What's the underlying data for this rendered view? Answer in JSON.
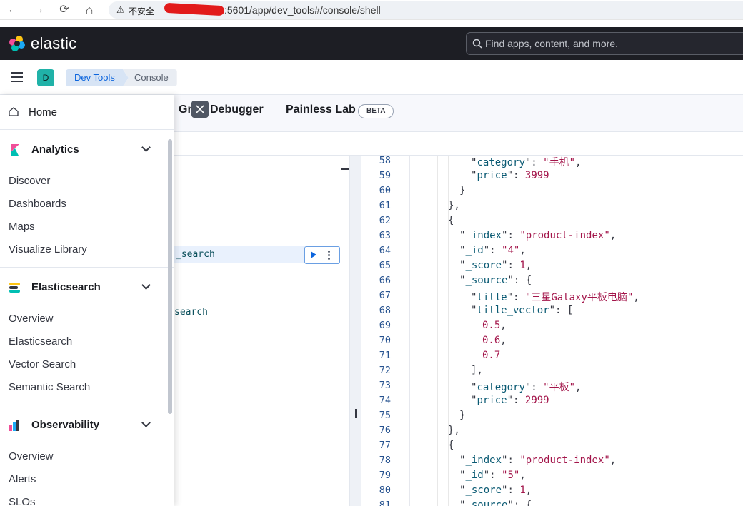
{
  "browser": {
    "back": "←",
    "forward": "→",
    "reload": "⟳",
    "home": "⌂",
    "security_label": "不安全",
    "url": ":5601/app/dev_tools#/console/shell"
  },
  "header": {
    "brand": "elastic",
    "search_placeholder": "Find apps, content, and more."
  },
  "subheader": {
    "avatar_letter": "D",
    "breadcrumbs": [
      "Dev Tools",
      "Console"
    ]
  },
  "tabs": {
    "grok": "Gr",
    "grok_rest": "Debugger",
    "painless": "Painless Lab",
    "beta": "BETA"
  },
  "editor": {
    "request_text": "_search",
    "second_text": "search"
  },
  "sidenav": {
    "home": "Home",
    "groups": [
      {
        "label": "Analytics",
        "items": [
          "Discover",
          "Dashboards",
          "Maps",
          "Visualize Library"
        ]
      },
      {
        "label": "Elasticsearch",
        "items": [
          "Overview",
          "Elasticsearch",
          "Vector Search",
          "Semantic Search"
        ]
      },
      {
        "label": "Observability",
        "items": [
          "Overview",
          "Alerts",
          "SLOs"
        ]
      }
    ]
  },
  "output": {
    "line_numbers": [
      "58",
      "59",
      "60",
      "61",
      "62",
      "63",
      "64",
      "65",
      "66",
      "67",
      "68",
      "69",
      "70",
      "71",
      "72",
      "73",
      "74",
      "75",
      "76",
      "77",
      "78",
      "79",
      "80",
      "81"
    ],
    "lines": [
      {
        "indent": 84,
        "parts": [
          [
            "p",
            "\""
          ],
          [
            "k",
            "category"
          ],
          [
            "p",
            "\": "
          ],
          [
            "s",
            "\"手机\""
          ],
          [
            "p",
            ","
          ]
        ]
      },
      {
        "indent": 84,
        "parts": [
          [
            "p",
            "\""
          ],
          [
            "k",
            "price"
          ],
          [
            "p",
            "\": "
          ],
          [
            "n",
            "3999"
          ]
        ]
      },
      {
        "indent": 68,
        "parts": [
          [
            "p",
            "}"
          ]
        ]
      },
      {
        "indent": 52,
        "parts": [
          [
            "p",
            "},"
          ]
        ]
      },
      {
        "indent": 52,
        "parts": [
          [
            "p",
            "{"
          ]
        ]
      },
      {
        "indent": 68,
        "parts": [
          [
            "p",
            "\""
          ],
          [
            "k",
            "_index"
          ],
          [
            "p",
            "\": "
          ],
          [
            "s",
            "\"product-index\""
          ],
          [
            "p",
            ","
          ]
        ]
      },
      {
        "indent": 68,
        "parts": [
          [
            "p",
            "\""
          ],
          [
            "k",
            "_id"
          ],
          [
            "p",
            "\": "
          ],
          [
            "s",
            "\"4\""
          ],
          [
            "p",
            ","
          ]
        ]
      },
      {
        "indent": 68,
        "parts": [
          [
            "p",
            "\""
          ],
          [
            "k",
            "_score"
          ],
          [
            "p",
            "\": "
          ],
          [
            "n",
            "1"
          ],
          [
            "p",
            ","
          ]
        ]
      },
      {
        "indent": 68,
        "parts": [
          [
            "p",
            "\""
          ],
          [
            "k",
            "_source"
          ],
          [
            "p",
            "\": {"
          ]
        ]
      },
      {
        "indent": 84,
        "parts": [
          [
            "p",
            "\""
          ],
          [
            "k",
            "title"
          ],
          [
            "p",
            "\": "
          ],
          [
            "s",
            "\"三星Galaxy平板电脑\""
          ],
          [
            "p",
            ","
          ]
        ]
      },
      {
        "indent": 84,
        "parts": [
          [
            "p",
            "\""
          ],
          [
            "k",
            "title_vector"
          ],
          [
            "p",
            "\": ["
          ]
        ]
      },
      {
        "indent": 100,
        "parts": [
          [
            "n",
            "0.5"
          ],
          [
            "p",
            ","
          ]
        ]
      },
      {
        "indent": 100,
        "parts": [
          [
            "n",
            "0.6"
          ],
          [
            "p",
            ","
          ]
        ]
      },
      {
        "indent": 100,
        "parts": [
          [
            "n",
            "0.7"
          ]
        ]
      },
      {
        "indent": 84,
        "parts": [
          [
            "p",
            "],"
          ]
        ]
      },
      {
        "indent": 84,
        "parts": [
          [
            "p",
            "\""
          ],
          [
            "k",
            "category"
          ],
          [
            "p",
            "\": "
          ],
          [
            "s",
            "\"平板\""
          ],
          [
            "p",
            ","
          ]
        ]
      },
      {
        "indent": 84,
        "parts": [
          [
            "p",
            "\""
          ],
          [
            "k",
            "price"
          ],
          [
            "p",
            "\": "
          ],
          [
            "n",
            "2999"
          ]
        ]
      },
      {
        "indent": 68,
        "parts": [
          [
            "p",
            "}"
          ]
        ]
      },
      {
        "indent": 52,
        "parts": [
          [
            "p",
            "},"
          ]
        ]
      },
      {
        "indent": 52,
        "parts": [
          [
            "p",
            "{"
          ]
        ]
      },
      {
        "indent": 68,
        "parts": [
          [
            "p",
            "\""
          ],
          [
            "k",
            "_index"
          ],
          [
            "p",
            "\": "
          ],
          [
            "s",
            "\"product-index\""
          ],
          [
            "p",
            ","
          ]
        ]
      },
      {
        "indent": 68,
        "parts": [
          [
            "p",
            "\""
          ],
          [
            "k",
            "_id"
          ],
          [
            "p",
            "\": "
          ],
          [
            "s",
            "\"5\""
          ],
          [
            "p",
            ","
          ]
        ]
      },
      {
        "indent": 68,
        "parts": [
          [
            "p",
            "\""
          ],
          [
            "k",
            "_score"
          ],
          [
            "p",
            "\": "
          ],
          [
            "n",
            "1"
          ],
          [
            "p",
            ","
          ]
        ]
      },
      {
        "indent": 68,
        "parts": [
          [
            "p",
            "\""
          ],
          [
            "k",
            "_source"
          ],
          [
            "p",
            "\": {"
          ]
        ]
      }
    ]
  }
}
